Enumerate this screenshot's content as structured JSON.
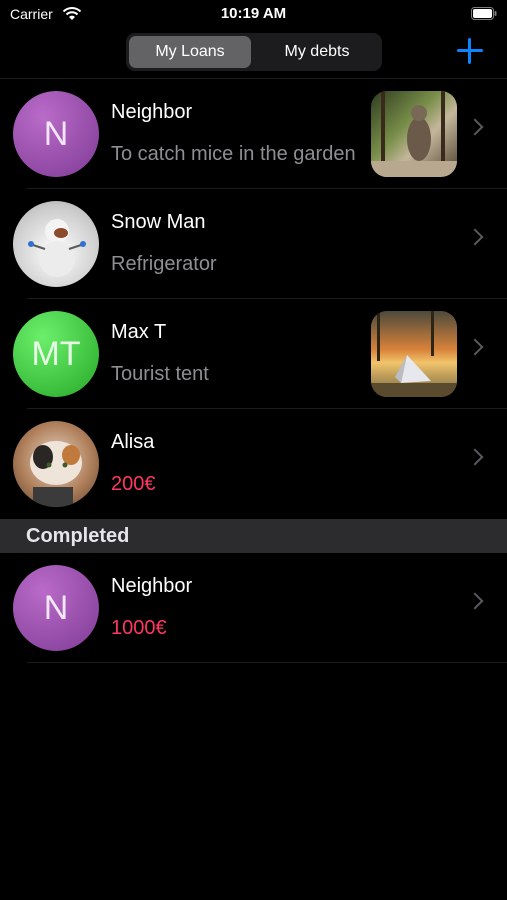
{
  "status_bar": {
    "carrier": "Carrier",
    "time": "10:19 AM"
  },
  "nav": {
    "segments": [
      "My Loans",
      "My debts"
    ],
    "selected": "My Loans",
    "add_icon": "plus-icon",
    "accent": "#0a84ff"
  },
  "loans": [
    {
      "name": "Neighbor",
      "detail": "To catch mice in the garden",
      "avatar": "N",
      "avatar_color": "#9b4fb0",
      "thumbnail": "cat-photo"
    },
    {
      "name": "Snow Man",
      "detail": "Refrigerator",
      "avatar": "snowman-photo"
    },
    {
      "name": "Max T",
      "detail": "Tourist tent",
      "avatar": "MT",
      "avatar_color": "#34c734",
      "thumbnail": "tent-photo"
    },
    {
      "name": "Alisa",
      "detail": "200€",
      "avatar": "cat-photo",
      "detail_color": "#ff375f"
    }
  ],
  "completed_section": {
    "header": "Completed",
    "items": [
      {
        "name": "Neighbor",
        "detail": "1000€",
        "avatar": "N",
        "avatar_color": "#9b4fb0",
        "detail_color": "#ff375f"
      }
    ]
  }
}
